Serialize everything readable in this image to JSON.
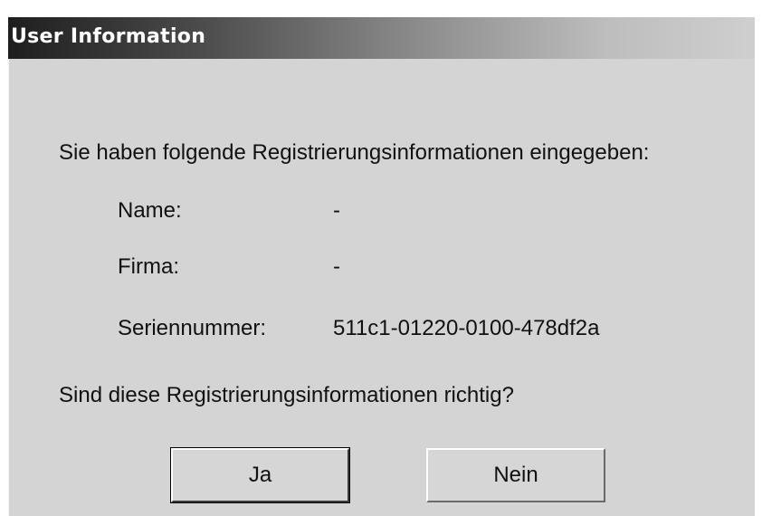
{
  "dialog": {
    "title": "User Information",
    "intro": "Sie haben folgende Registrierungsinformationen eingegeben:",
    "fields": [
      {
        "label": "Name:",
        "value": "-"
      },
      {
        "label": "Firma:",
        "value": "-"
      },
      {
        "label": "Seriennummer:",
        "value": "511c1-01220-0100-478df2a"
      }
    ],
    "question": "Sind diese Registrierungsinformationen richtig?",
    "buttons": {
      "yes": "Ja",
      "no": "Nein"
    }
  }
}
